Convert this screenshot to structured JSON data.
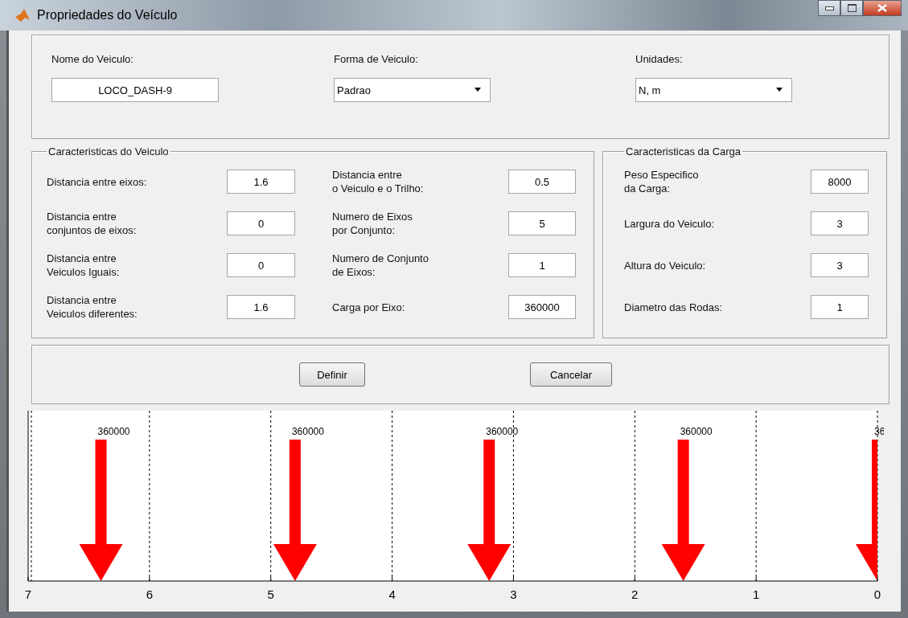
{
  "window": {
    "title": "Propriedades do Veículo"
  },
  "header": {
    "fields": [
      {
        "label": "Nome do Veiculo:",
        "kind": "text",
        "value": "LOCO_DASH-9"
      },
      {
        "label": "Forma de Veiculo:",
        "kind": "dropdown",
        "value": "Padrao"
      },
      {
        "label": "Unidades:",
        "kind": "dropdown",
        "value": "N, m"
      }
    ]
  },
  "vehicle": {
    "title": "Caracteristicas do Veiculo",
    "fields": [
      {
        "label": "Distancia entre eixos:",
        "value": "1.6"
      },
      {
        "label": "Distancia entre\nconjuntos de eixos:",
        "value": "0"
      },
      {
        "label": "Distancia entre\nVeiculos Iguais:",
        "value": "0"
      },
      {
        "label": "Distancia entre\nVeiculos diferentes:",
        "value": "1.6"
      },
      {
        "label": "Distancia entre\no Veiculo e o Trilho:",
        "value": "0.5"
      },
      {
        "label": "Numero de Eixos\npor Conjunto:",
        "value": "5"
      },
      {
        "label": "Numero de Conjunto\nde Eixos:",
        "value": "1"
      },
      {
        "label": "Carga por Eixo:",
        "value": "360000"
      }
    ]
  },
  "load": {
    "title": "Caracteristicas da Carga",
    "fields": [
      {
        "label": "Peso Especifico\nda Carga:",
        "value": "8000"
      },
      {
        "label": "Largura do Veiculo:",
        "value": "3"
      },
      {
        "label": "Altura do Veiculo:",
        "value": "3"
      },
      {
        "label": "Diametro das Rodas:",
        "value": "1"
      }
    ]
  },
  "buttons": [
    "Definir",
    "Cancelar"
  ],
  "plot": {
    "load_labels": [
      "360000",
      "360000",
      "360000",
      "360000",
      "36"
    ],
    "axis_labels": [
      "7",
      "6",
      "5",
      "4",
      "3",
      "2",
      "1",
      "0"
    ]
  }
}
